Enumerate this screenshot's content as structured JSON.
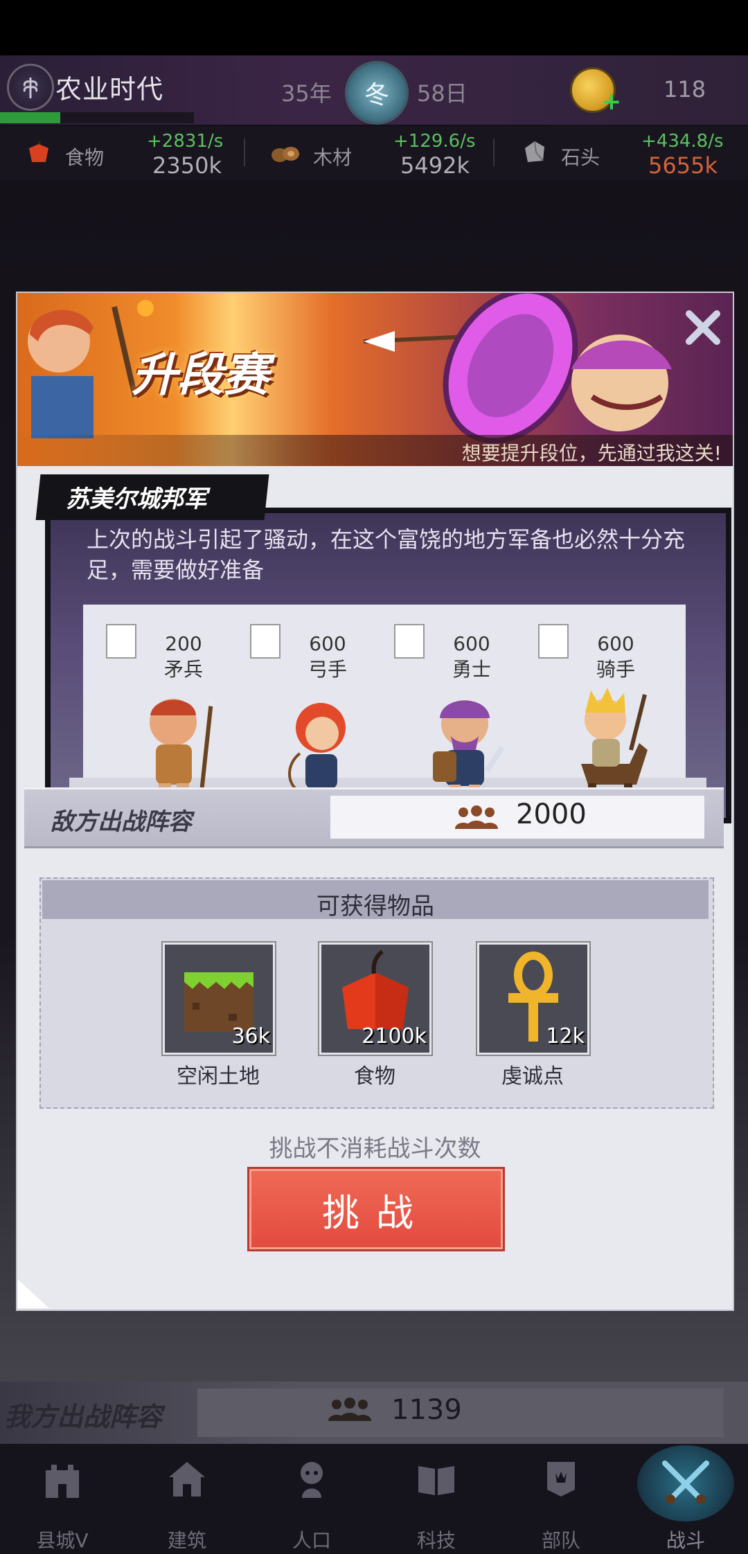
{
  "header": {
    "era_name": "农业时代",
    "era_progress": 0.31,
    "year": "35年",
    "season": "冬",
    "day": "58日",
    "coins": "118"
  },
  "resources": [
    {
      "name": "食物",
      "rate": "+2831/s",
      "value": "2350k",
      "value_color": "#b3b0b8"
    },
    {
      "name": "木材",
      "rate": "+129.6/s",
      "value": "5492k",
      "value_color": "#b3b0b8"
    },
    {
      "name": "石头",
      "rate": "+434.8/s",
      "value": "5655k",
      "value_color": "#d2643a"
    }
  ],
  "modal": {
    "title": "升段赛",
    "subtitle": "想要提升段位，先通过我这关!",
    "enemy_name": "苏美尔城邦军",
    "enemy_description": "上次的战斗引起了骚动，在这个富饶的地方军备也必然十分充足，需要做好准备",
    "units": [
      {
        "count": "200",
        "type": "矛兵",
        "flag_level": "1"
      },
      {
        "count": "600",
        "type": "弓手",
        "flag_level": "1"
      },
      {
        "count": "600",
        "type": "勇士",
        "flag_level": "1"
      },
      {
        "count": "600",
        "type": "骑手",
        "flag_level": "1"
      }
    ],
    "enemy_lineup_label": "敌方出战阵容",
    "enemy_total": "2000",
    "rewards_title": "可获得物品",
    "rewards": [
      {
        "label": "空闲土地",
        "qty": "36k",
        "icon": "land-icon"
      },
      {
        "label": "食物",
        "qty": "2100k",
        "icon": "food-icon"
      },
      {
        "label": "虔诚点",
        "qty": "12k",
        "icon": "ankh-icon"
      }
    ],
    "challenge_note": "挑战不消耗战斗次数",
    "challenge_button": "挑战"
  },
  "background": {
    "my_lineup_label": "我方出战阵容",
    "my_total": "1139"
  },
  "nav": [
    {
      "label": "县城V",
      "icon": "castle-icon"
    },
    {
      "label": "建筑",
      "icon": "house-icon"
    },
    {
      "label": "人口",
      "icon": "person-icon"
    },
    {
      "label": "科技",
      "icon": "book-icon"
    },
    {
      "label": "部队",
      "icon": "banner-icon"
    },
    {
      "label": "战斗",
      "icon": "swords-icon"
    }
  ],
  "colors": {
    "accent_green": "#5cc061",
    "challenge_red": "#e24a3e",
    "modal_bg": "#e8e8ef"
  }
}
